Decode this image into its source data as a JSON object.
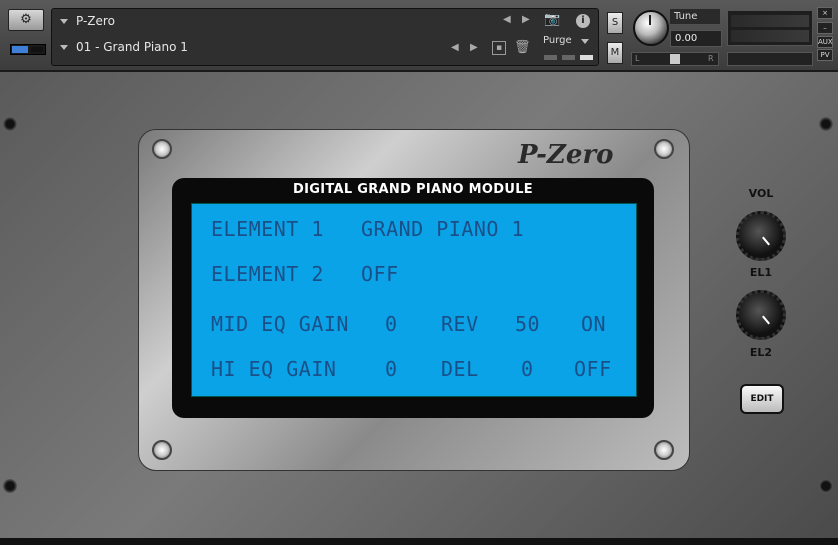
{
  "header": {
    "instrument_name": "P-Zero",
    "preset_name": "01 - Grand Piano 1",
    "purge_label": "Purge",
    "tune_label": "Tune",
    "tune_value": "0.00",
    "solo_label": "S",
    "mute_label": "M",
    "pan_left": "L",
    "pan_right": "R",
    "close_label": "×",
    "minimize_label": "–",
    "aux_label": "AUX",
    "pv_label": "PV",
    "info_label": "i"
  },
  "panel": {
    "logo_text": "P-Zero",
    "module_title": "DIGITAL GRAND PIANO MODULE",
    "lcd": {
      "row1": [
        "ELEMENT 1",
        "GRAND PIANO 1"
      ],
      "row2": [
        "ELEMENT 2",
        "OFF"
      ],
      "row3": [
        "MID EQ GAIN",
        "0",
        "REV",
        "50",
        "ON"
      ],
      "row4": [
        "HI EQ GAIN",
        "0",
        "DEL",
        "0",
        "OFF"
      ]
    },
    "vol_label": "VOL",
    "el1_label": "EL1",
    "el2_label": "EL2",
    "edit_label": "EDIT"
  },
  "colors": {
    "lcd_background": "#0aa3e8",
    "lcd_text": "#1b4f88",
    "accent_meter": "#3f7fd8"
  }
}
